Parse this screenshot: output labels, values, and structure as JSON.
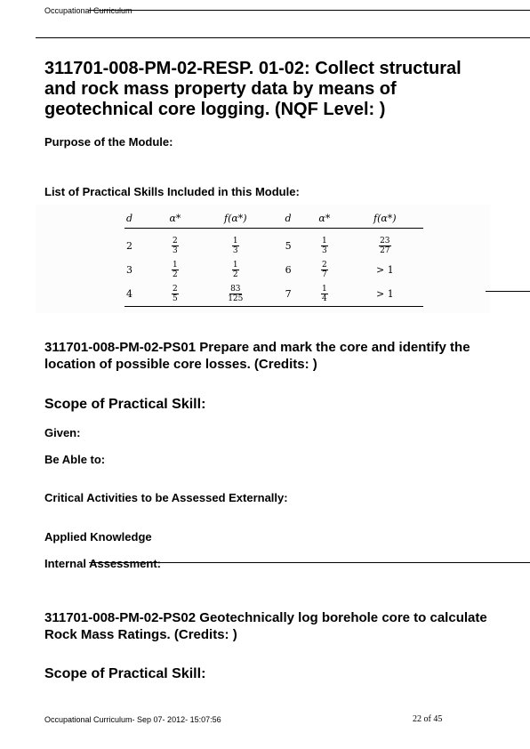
{
  "header": {
    "text": "Occupational Curriculum"
  },
  "module": {
    "title": "311701-008-PM-02-RESP. 01-02: Collect structural and rock mass property data by means of geotechnical core logging. (NQF Level: )",
    "purpose_label": "Purpose of the Module:",
    "skills_label": "List of Practical Skills Included in this Module:"
  },
  "table": {
    "headers": [
      "d",
      "α*",
      "f(α*)",
      "d",
      "α*",
      "f(α*)"
    ],
    "rows": [
      [
        "2",
        "2/3",
        "1/3",
        "5",
        "1/3",
        "23/27"
      ],
      [
        "3",
        "1/2",
        "1/2",
        "6",
        "2/7",
        "> 1"
      ],
      [
        "4",
        "2/5",
        "83/125",
        "7",
        "1/4",
        "> 1"
      ]
    ]
  },
  "ps01": {
    "title": "311701-008-PM-02-PS01 Prepare and mark the core and identify the location of possible core losses. (Credits: )",
    "scope": "Scope of Practical Skill:",
    "given": "Given:",
    "able": "Be Able to:",
    "critical": "Critical Activities to be Assessed Externally:",
    "applied": "Applied Knowledge",
    "internal": "Internal Assessment:"
  },
  "ps02": {
    "title": "311701-008-PM-02-PS02 Geotechnically log borehole core to calculate Rock Mass Ratings.  (Credits: )",
    "scope": "Scope of Practical Skill:"
  },
  "footer": {
    "text": "Occupational  Curriculum- Sep 07-  2012- 15:07:56",
    "page": "22 of 45"
  }
}
